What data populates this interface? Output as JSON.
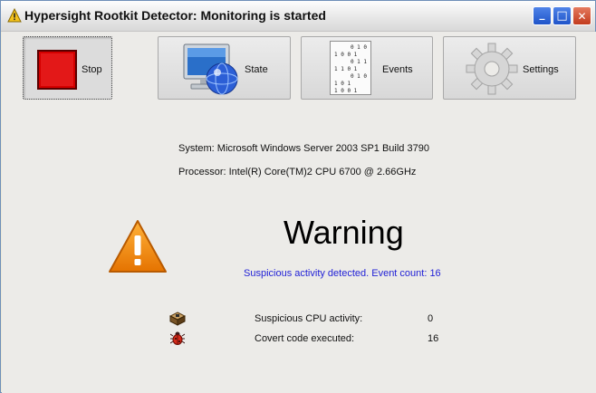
{
  "window": {
    "title": "Hypersight Rootkit Detector: Monitoring is started",
    "controls": {
      "minimize": "_",
      "maximize": "□",
      "close": "✕"
    }
  },
  "toolbar": {
    "stop_label": "Stop",
    "state_label": "State",
    "events_label": "Events",
    "settings_label": "Settings",
    "events_icon_text": [
      "0 1  0",
      "1  0 0 1",
      "0 1 1",
      "1  1 0 1",
      "0 1  0",
      "1 0 1",
      "1  0 0 1"
    ]
  },
  "system_info": {
    "system": "System: Microsoft Windows Server 2003 SP1 Build 3790",
    "processor": "Processor: Intel(R) Core(TM)2 CPU 6700 @ 2.66GHz"
  },
  "status": {
    "title": "Warning",
    "message": "Suspicious activity detected. Event count: 16",
    "message_color": "#1f1fd6"
  },
  "details": [
    {
      "icon": "cpu-chip-icon",
      "label": "Suspicious CPU activity:",
      "value": "0"
    },
    {
      "icon": "bug-icon",
      "label": "Covert code executed:",
      "value": "16"
    }
  ],
  "colors": {
    "stop_red": "#d40000",
    "warning_orange": "#f08a00",
    "titlebar_blue": "#2a5bd7"
  }
}
